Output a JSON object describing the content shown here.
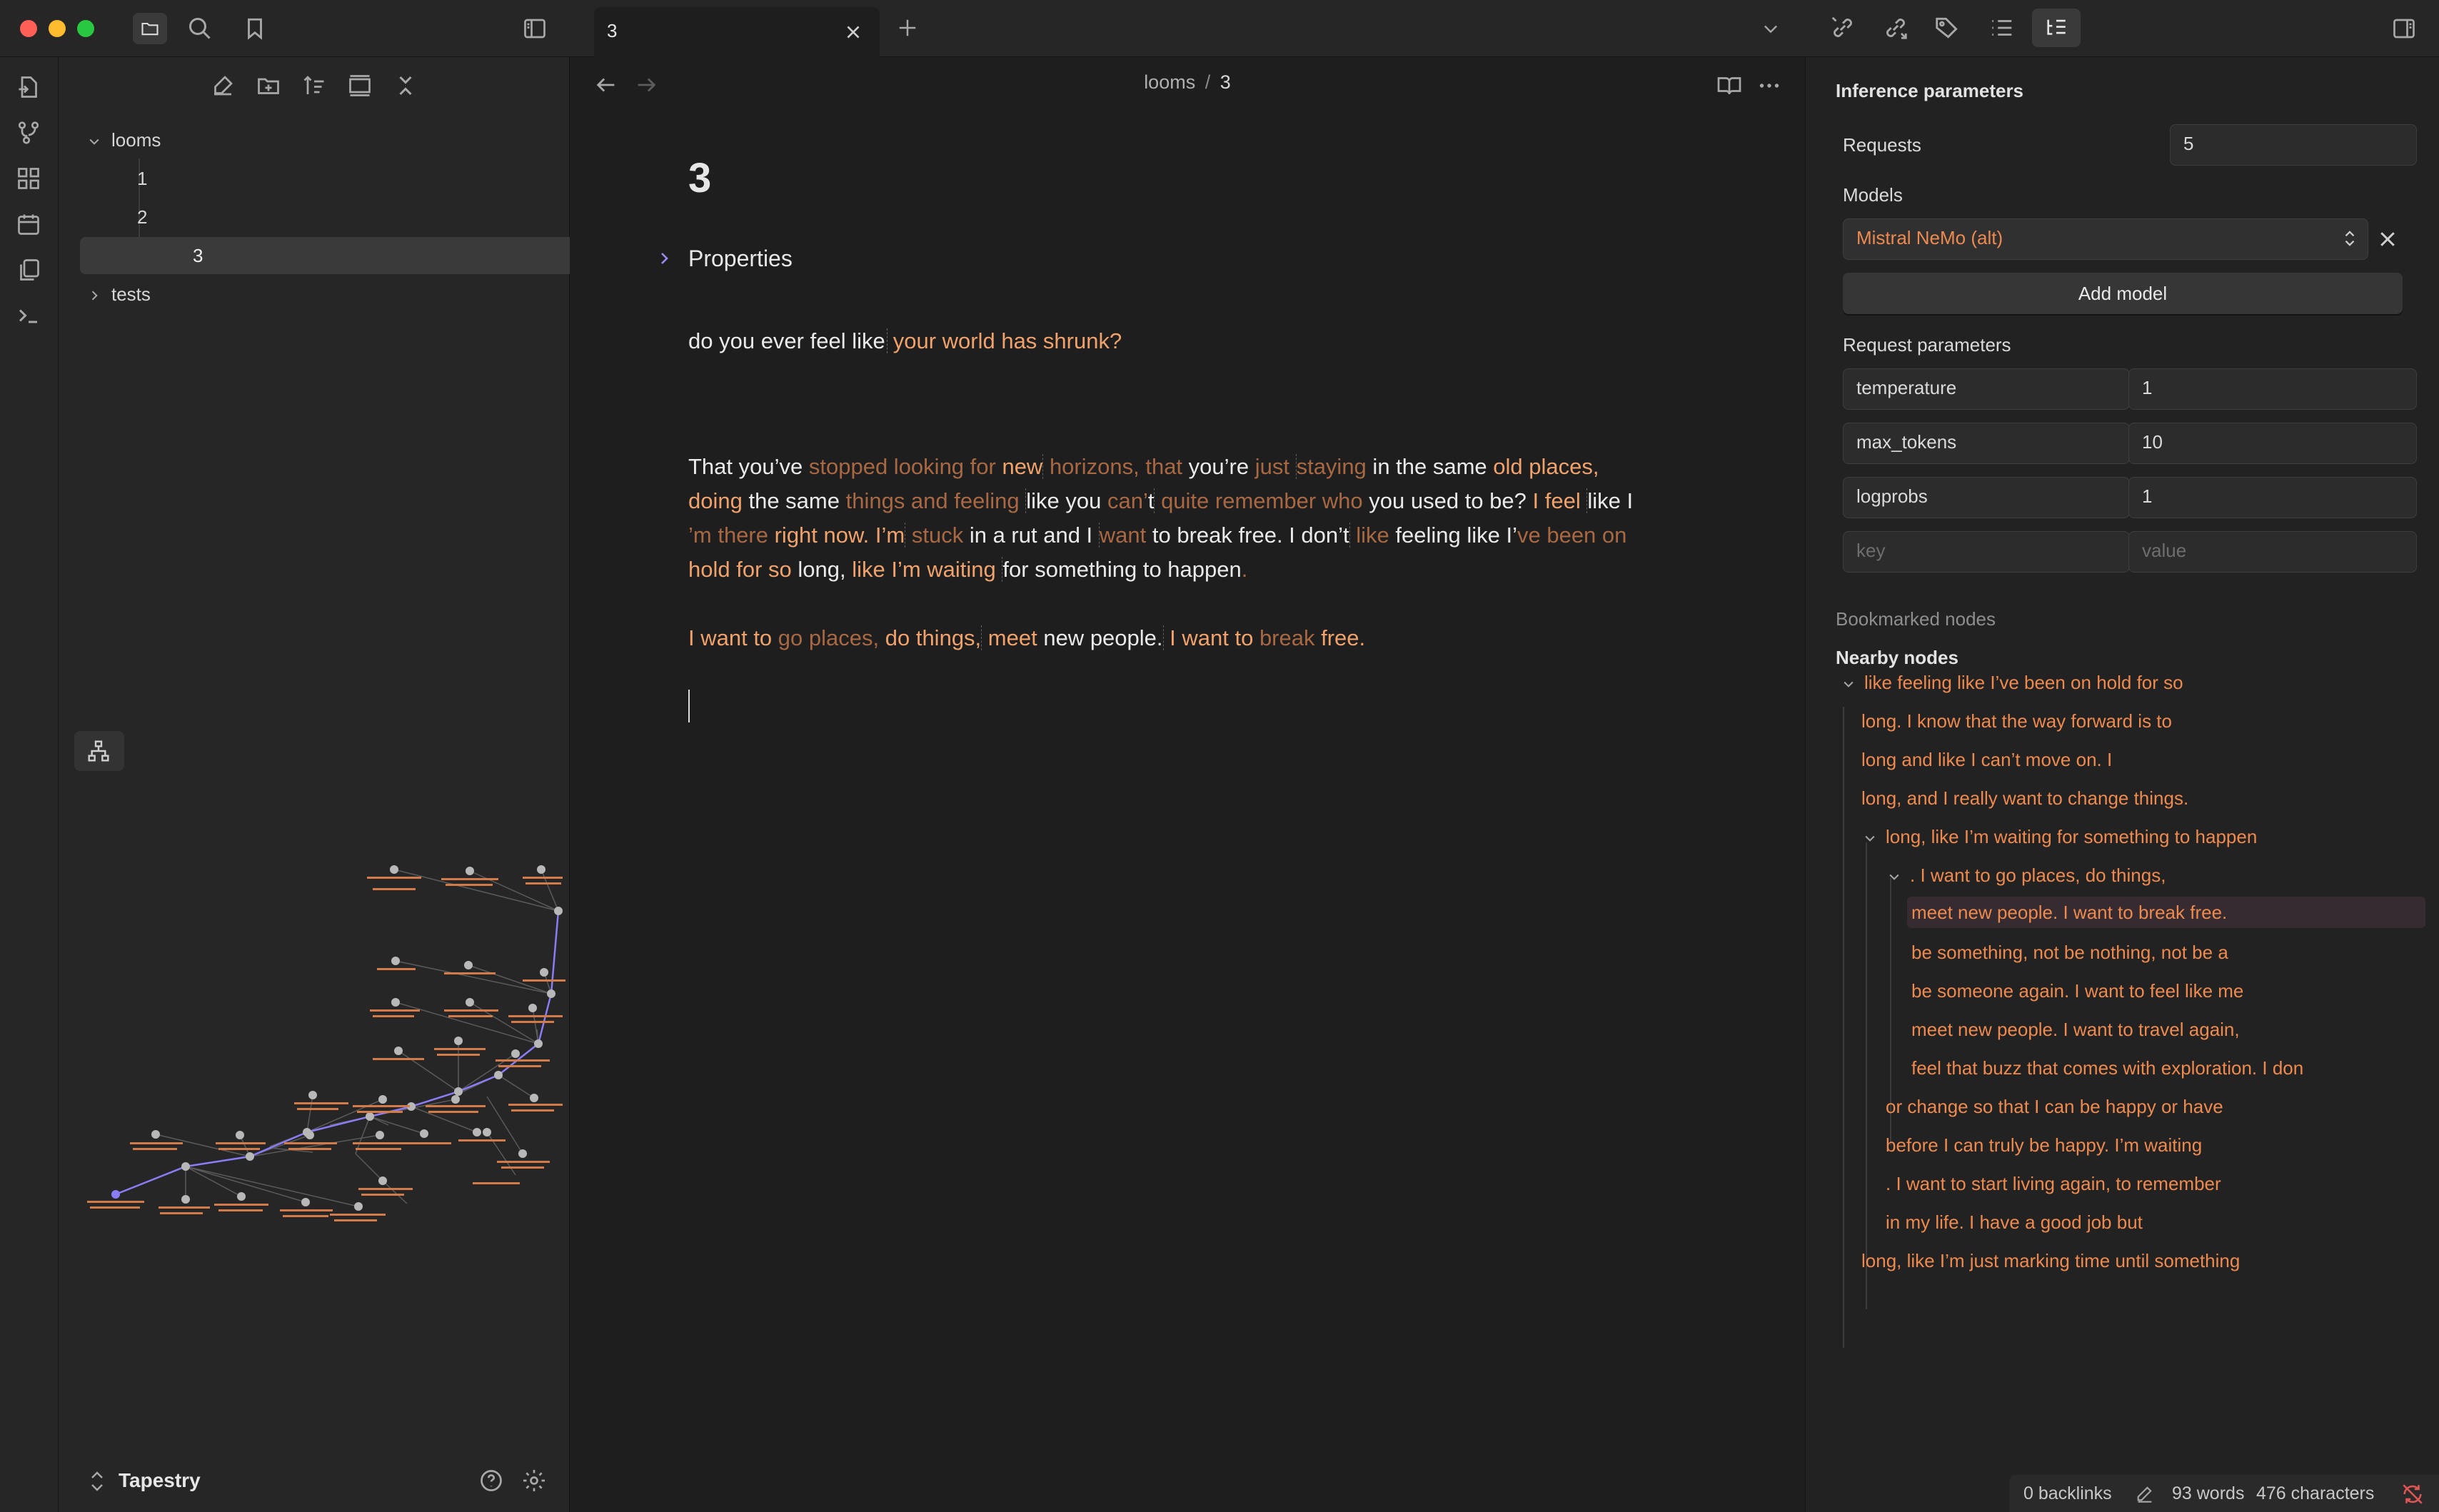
{
  "window": {
    "tab_title": "3",
    "traffic_lights": [
      "#ff5f57",
      "#febc2e",
      "#28c840"
    ]
  },
  "file_tree": {
    "root": "looms",
    "children": [
      "1",
      "2",
      "3"
    ],
    "selected": "3",
    "collapsed_folder": "tests"
  },
  "vault": {
    "name": "Tapestry"
  },
  "editor": {
    "breadcrumb_parent": "looms",
    "breadcrumb_sep": "/",
    "breadcrumb_current": "3",
    "title": "3",
    "properties_label": "Properties",
    "line1_a": "do you ever feel like",
    "line1_b": "your world has shrunk?",
    "para2_line1": [
      [
        "w",
        "That you’ve"
      ],
      [
        "d",
        " stopped looking for "
      ],
      [
        "s",
        "new"
      ],
      [
        "d",
        " horizons, that "
      ],
      [
        "w",
        "you’re"
      ],
      [
        "d",
        " just "
      ],
      [
        "d",
        "staying"
      ],
      [
        "w",
        " in the same"
      ],
      [
        "s",
        " old places,"
      ]
    ],
    "para2_line2": [
      [
        "s",
        "doing "
      ],
      [
        "w",
        "the same"
      ],
      [
        "d",
        " things and feeling "
      ],
      [
        "w",
        "like you"
      ],
      [
        "d",
        " can’"
      ],
      [
        "w",
        "t"
      ],
      [
        "d",
        " quite remember who "
      ],
      [
        "w",
        "you used to be?"
      ],
      [
        "s",
        " I feel "
      ],
      [
        "w",
        "like I"
      ]
    ],
    "para2_line3": [
      [
        "d",
        "’m"
      ],
      [
        "d",
        " there "
      ],
      [
        "s",
        "right now. I’m"
      ],
      [
        "d",
        " stuck "
      ],
      [
        "w",
        "in a rut"
      ],
      [
        "w",
        " and I "
      ],
      [
        "d",
        "want "
      ],
      [
        "w",
        "to break free. I "
      ],
      [
        "w",
        "don’t"
      ],
      [
        "d",
        " like "
      ],
      [
        "w",
        "feeling like I’"
      ],
      [
        "d",
        "ve been on"
      ]
    ],
    "para2_line4": [
      [
        "s",
        " hold for so"
      ],
      [
        "w",
        " long,"
      ],
      [
        "s",
        " like I’m waiting "
      ],
      [
        "w",
        "for something to happen"
      ],
      [
        "d",
        "."
      ]
    ],
    "para3": [
      [
        "s",
        "I want to "
      ],
      [
        "d",
        "go places,"
      ],
      [
        "s",
        " do things,"
      ],
      [
        "s",
        " meet "
      ],
      [
        "w",
        "new "
      ],
      [
        "w",
        "people."
      ],
      [
        "s",
        " I want to "
      ],
      [
        "d",
        "break"
      ],
      [
        "s",
        " free."
      ]
    ]
  },
  "inference": {
    "header": "Inference parameters",
    "requests_label": "Requests",
    "requests_value": "5",
    "models_label": "Models",
    "model_selected": "Mistral NeMo (alt)",
    "add_model_label": "Add model",
    "request_params_label": "Request parameters",
    "params": [
      {
        "key": "temperature",
        "value": "1"
      },
      {
        "key": "max_tokens",
        "value": "10"
      },
      {
        "key": "logprobs",
        "value": "1"
      }
    ],
    "key_placeholder": "key",
    "value_placeholder": "value",
    "bookmarked_label": "Bookmarked nodes",
    "nearby_label": "Nearby nodes",
    "nodes": [
      {
        "text": "like feeling like I’ve been on hold for so",
        "chevron": true
      },
      {
        "text": "long. I know that the way forward is to"
      },
      {
        "text": "long and like I can’t move on. I"
      },
      {
        "text": "long, and I really want to change things."
      },
      {
        "text": "long, like I’m waiting for something to happen",
        "chevron": true
      },
      {
        "text": ". I want to go places, do things,",
        "chevron": true
      },
      {
        "text": "meet new people. I want to break free.",
        "selected": true
      },
      {
        "text": "be something, not be nothing, not be a"
      },
      {
        "text": "be someone again. I want to feel like me"
      },
      {
        "text": "meet new people. I want to travel again,"
      },
      {
        "text": "feel that buzz that comes with exploration. I don"
      },
      {
        "text": "or change so that I can be happy or have"
      },
      {
        "text": "before I can truly be happy. I’m waiting"
      },
      {
        "text": ". I want to start living again, to remember"
      },
      {
        "text": "in my life. I have a good job but"
      },
      {
        "text": "long, like I’m just marking time until something"
      }
    ]
  },
  "status": {
    "backlinks": "0 backlinks",
    "words": "93 words",
    "characters": "476 characters"
  },
  "colors": {
    "accent_orange": "#e8874f",
    "graph_edge_highlight": "#8a7cf5"
  }
}
